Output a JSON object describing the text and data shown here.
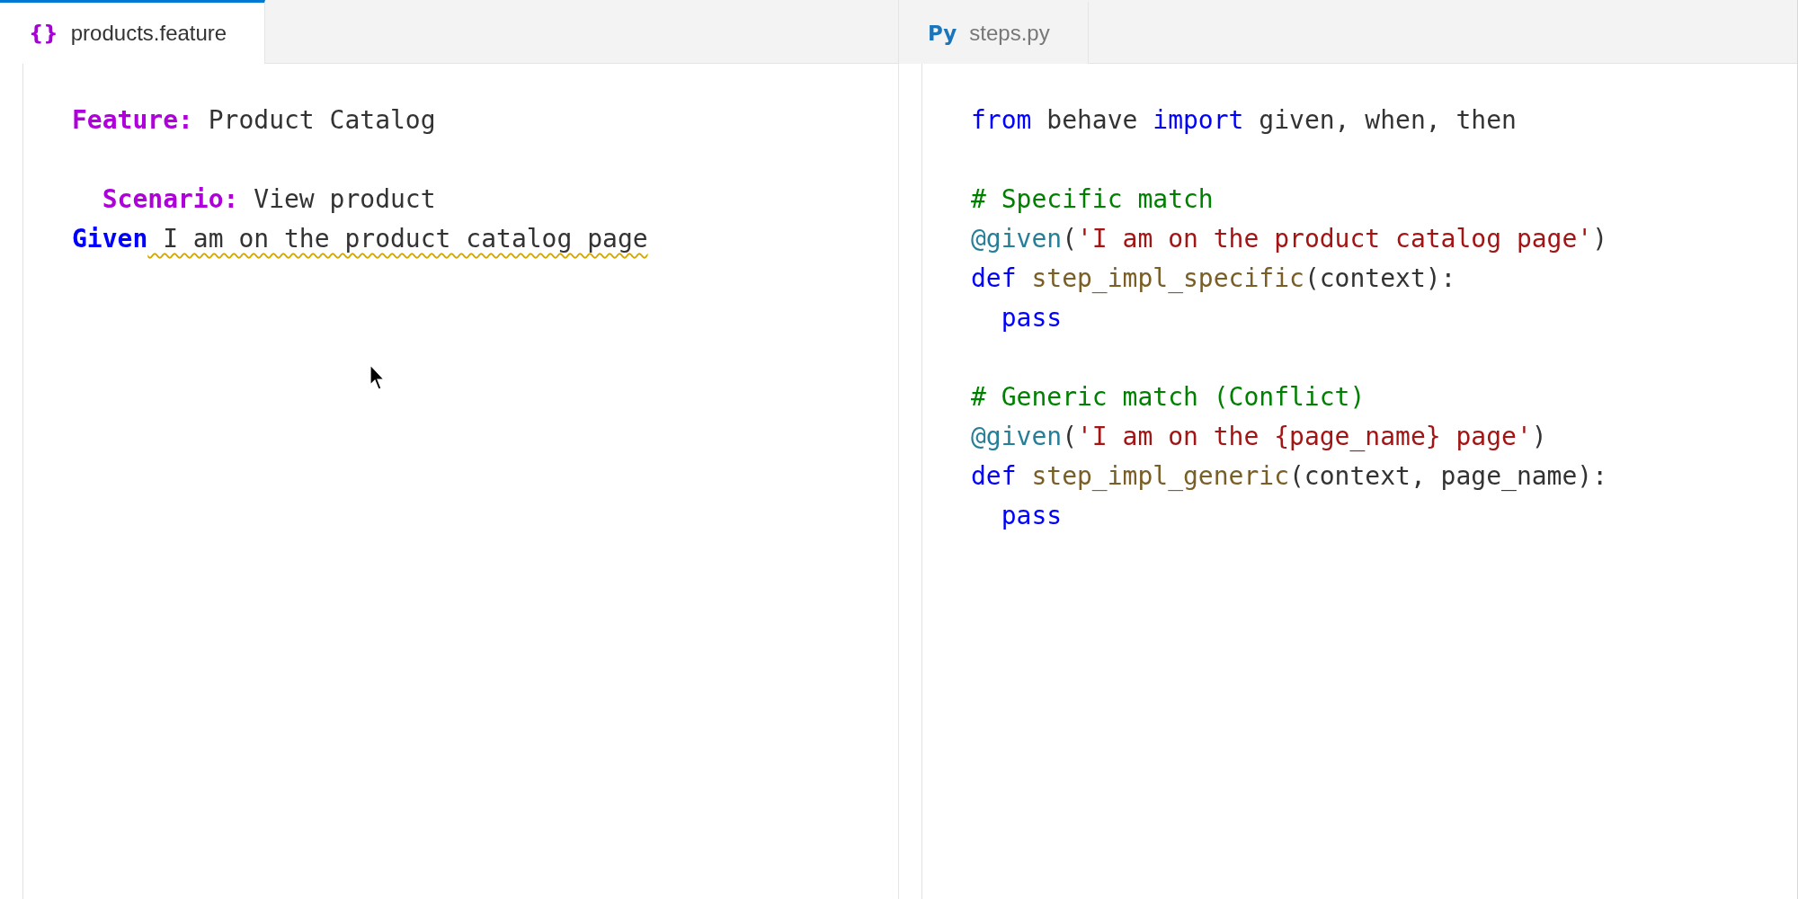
{
  "panes": [
    {
      "tab": {
        "icon": {
          "text": "{}",
          "color": "#a800d8"
        },
        "label": "products.feature",
        "selected": true
      },
      "lines": [
        {
          "kind": "code",
          "indented": false,
          "tokens": [
            {
              "kind": "gherkin-keyword",
              "text": "Feature:"
            },
            {
              "kind": "plain",
              "text": " Product Catalog"
            }
          ]
        },
        {
          "kind": "blank"
        },
        {
          "kind": "code",
          "indented": true,
          "tokens": [
            {
              "kind": "gherkin-keyword",
              "text": "Scenario:"
            },
            {
              "kind": "plain",
              "text": " View product"
            }
          ]
        },
        {
          "kind": "code",
          "indented": false,
          "tokens": [
            {
              "kind": "step-keyword",
              "text": "Given"
            },
            {
              "kind": "plain",
              "text": " I am on the product catalog page",
              "warning": true
            }
          ]
        }
      ]
    },
    {
      "tab": {
        "icon": {
          "text": "Py",
          "color": "#1b75bb"
        },
        "label": "steps.py",
        "selected": false
      },
      "lines": [
        {
          "kind": "code",
          "indented": false,
          "tokens": [
            {
              "kind": "keyword",
              "text": "from"
            },
            {
              "kind": "plain",
              "text": " behave "
            },
            {
              "kind": "keyword",
              "text": "import"
            },
            {
              "kind": "plain",
              "text": " given, when, then"
            }
          ]
        },
        {
          "kind": "blank"
        },
        {
          "kind": "code",
          "indented": false,
          "tokens": [
            {
              "kind": "comment",
              "text": "# Specific match"
            }
          ]
        },
        {
          "kind": "code",
          "indented": false,
          "tokens": [
            {
              "kind": "decorator",
              "text": "@given"
            },
            {
              "kind": "plain",
              "text": "("
            },
            {
              "kind": "string",
              "text": "'I am on the product catalog page'"
            },
            {
              "kind": "plain",
              "text": ")"
            }
          ]
        },
        {
          "kind": "code",
          "indented": false,
          "tokens": [
            {
              "kind": "keyword",
              "text": "def"
            },
            {
              "kind": "function",
              "text": " step_impl_specific"
            },
            {
              "kind": "plain",
              "text": "(context):"
            }
          ]
        },
        {
          "kind": "code",
          "indented": true,
          "tokens": [
            {
              "kind": "keyword",
              "text": "pass"
            }
          ]
        },
        {
          "kind": "blank"
        },
        {
          "kind": "code",
          "indented": false,
          "tokens": [
            {
              "kind": "comment",
              "text": "# Generic match (Conflict)"
            }
          ]
        },
        {
          "kind": "code",
          "indented": false,
          "tokens": [
            {
              "kind": "decorator",
              "text": "@given"
            },
            {
              "kind": "plain",
              "text": "("
            },
            {
              "kind": "string",
              "text": "'I am on the {page_name} page'"
            },
            {
              "kind": "plain",
              "text": ")"
            }
          ]
        },
        {
          "kind": "code",
          "indented": false,
          "tokens": [
            {
              "kind": "keyword",
              "text": "def"
            },
            {
              "kind": "function",
              "text": " step_impl_generic"
            },
            {
              "kind": "plain",
              "text": "(context, page_name):"
            }
          ]
        },
        {
          "kind": "code",
          "indented": true,
          "tokens": [
            {
              "kind": "keyword",
              "text": "pass"
            }
          ]
        }
      ]
    }
  ]
}
